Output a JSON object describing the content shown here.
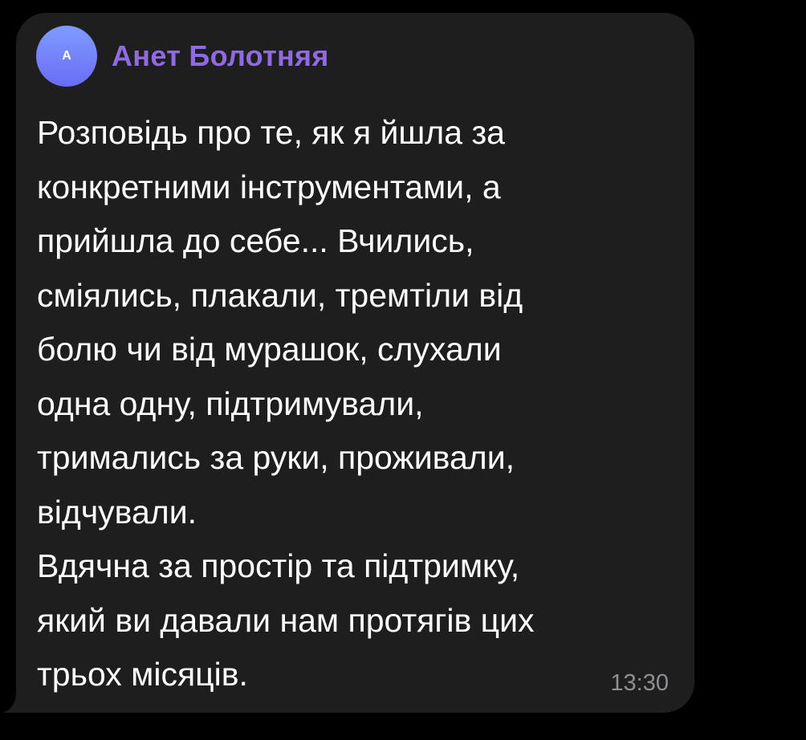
{
  "message": {
    "avatar_initial": "A",
    "sender_name": "Анет Болотняя",
    "sender_color": "#8f6ae0",
    "text": "Розповідь про те, як я йшла за\nконкретними інструментами, а\nприйшла до себе... Вчились,\nсміялись, плакали, тремтіли від\nболю чи від мурашок, слухали\nодна одну, підтримували,\nтримались за руки, проживали,\nвідчували.\nВдячна за простір та підтримку,\nякий ви давали нам протягів цих\nтрьох місяців.",
    "time": "13:30"
  },
  "colors": {
    "background": "#000000",
    "bubble": "#1e1e1e",
    "text": "#ffffff",
    "time": "#8e8e93"
  }
}
